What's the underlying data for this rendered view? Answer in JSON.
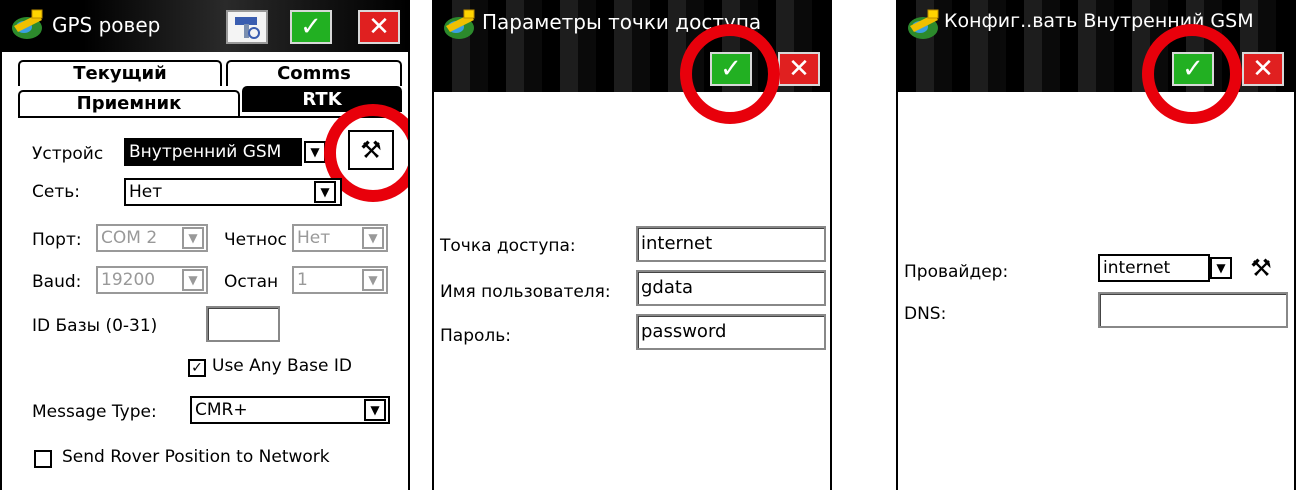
{
  "icons": {
    "app": "satellite-globe-icon",
    "ok": "checkmark-icon",
    "close": "close-icon",
    "satellite_button": "satellite-tool-icon",
    "settings": "tools-icon",
    "dropdown": "chevron-down-icon",
    "checkbox": "checkmark-icon"
  },
  "colors": {
    "ok_button": "#22b022",
    "close_button": "#e02020",
    "highlight_ring": "#e8000b",
    "titlebar": "#000000"
  },
  "screen1": {
    "title": "GPS ровер",
    "tabs": [
      "Текущий",
      "Comms",
      "Приемник",
      "RTK"
    ],
    "active_tab": "RTK",
    "device_label": "Устройс",
    "device_value": "Внутренний GSM",
    "network_label": "Сеть:",
    "network_value": "Нет",
    "port_label": "Порт:",
    "port_value": "COM 2",
    "parity_label": "Четнос",
    "parity_value": "Нет",
    "baud_label": "Baud:",
    "baud_value": "19200",
    "stop_label": "Остан",
    "stop_value": "1",
    "base_id_label": "ID Базы (0-31)",
    "base_id_value": "",
    "use_any_base_label": "Use Any Base ID",
    "use_any_base_checked": true,
    "message_type_label": "Message Type:",
    "message_type_value": "CMR+",
    "send_rover_label": "Send Rover Position to Network",
    "send_rover_checked": false
  },
  "screen2": {
    "title": "Параметры точки доступа",
    "access_point_label": "Точка доступа:",
    "access_point_value": "internet",
    "username_label": "Имя пользователя:",
    "username_value": "gdata",
    "password_label": "Пароль:",
    "password_value": "password"
  },
  "screen3": {
    "title": "Конфиг..вать Внутренний GSM",
    "provider_label": "Провайдер:",
    "provider_value": "internet",
    "dns_label": "DNS:",
    "dns_value": ""
  }
}
